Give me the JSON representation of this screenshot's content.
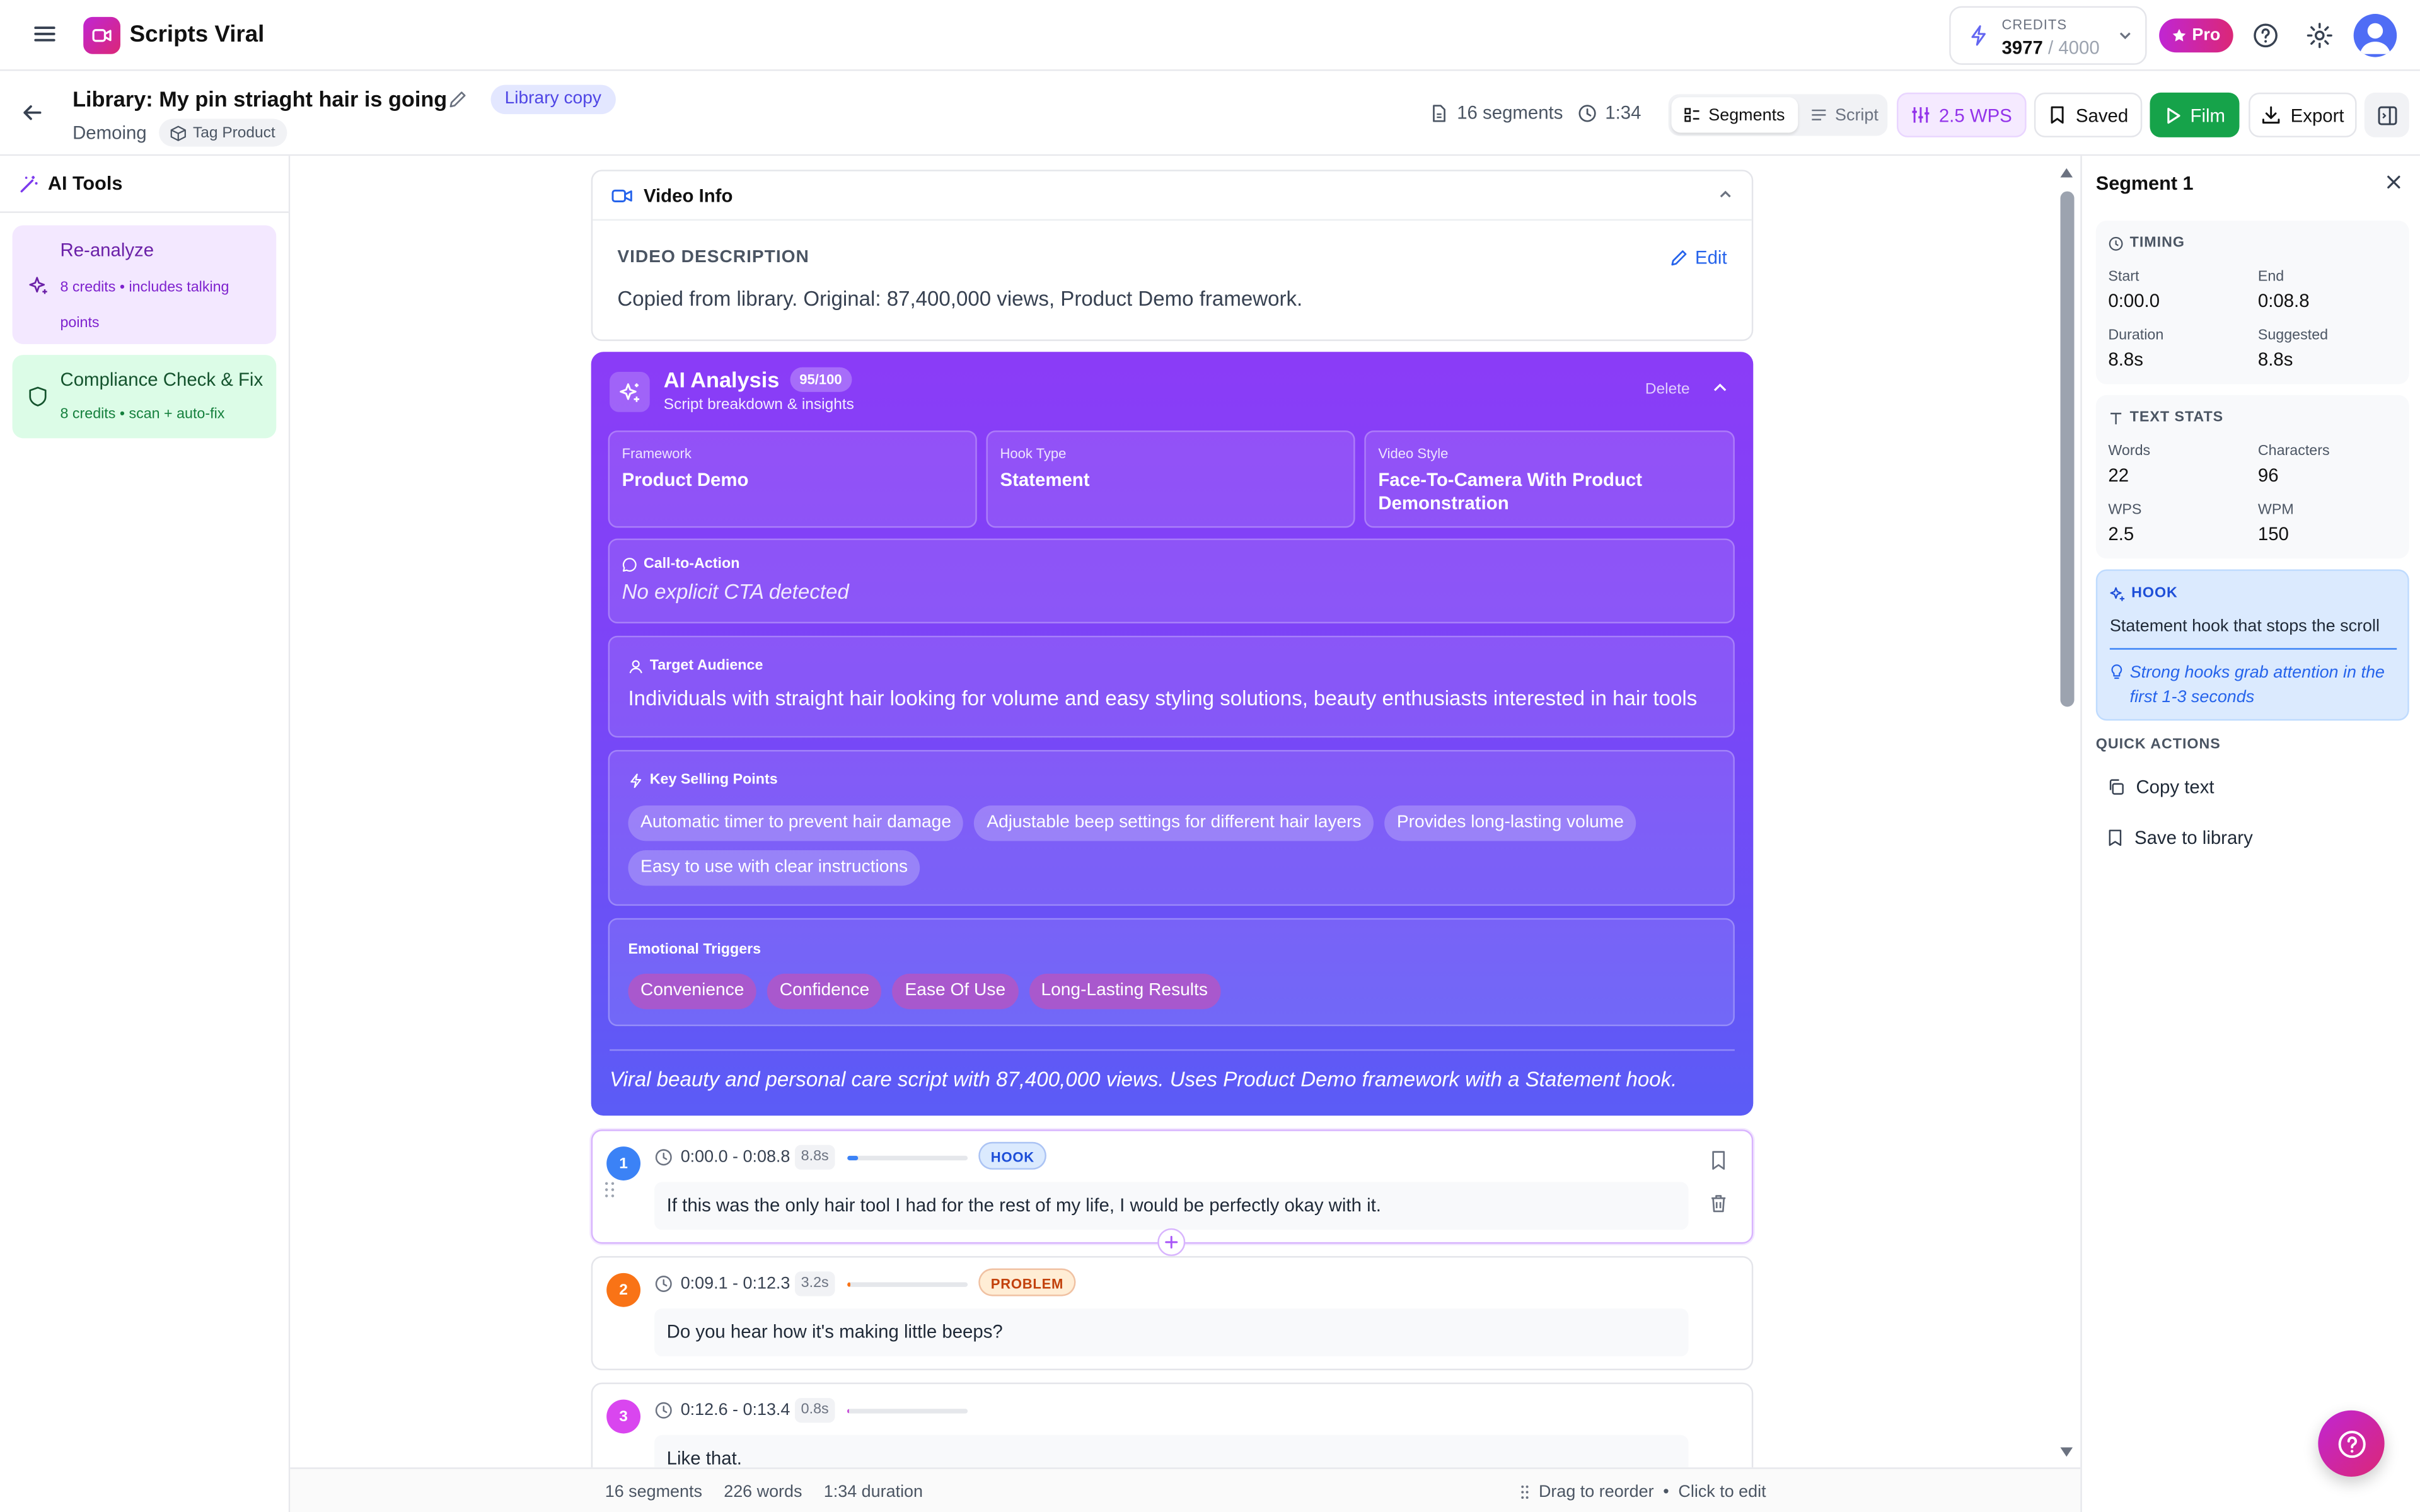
{
  "app": {
    "name": "Scripts Viral"
  },
  "credits": {
    "label": "CREDITS",
    "used": "3977",
    "total": "/ 4000"
  },
  "plan": {
    "badge": "Pro"
  },
  "header": {
    "title": "Library: My pin striaght hair is going",
    "badge": "Library copy",
    "subtitle": "Demoing",
    "tag": "Tag Product",
    "segments": "16 segments",
    "duration": "1:34",
    "view_segments": "Segments",
    "view_script": "Script",
    "wps": "2.5 WPS",
    "saved": "Saved",
    "film": "Film",
    "export": "Export"
  },
  "sidebar": {
    "title": "AI Tools",
    "tools": [
      {
        "title": "Re-analyze",
        "desc": "8 credits • includes talking points"
      },
      {
        "title": "Compliance Check & Fix",
        "desc": "8 credits • scan + auto-fix"
      }
    ]
  },
  "video_info": {
    "title": "Video Info",
    "label": "VIDEO DESCRIPTION",
    "edit": "Edit",
    "text": "Copied from library. Original: 87,400,000 views, Product Demo framework."
  },
  "ai_analysis": {
    "title": "AI Analysis",
    "score": "95/100",
    "subtitle": "Script breakdown & insights",
    "delete": "Delete",
    "framework_label": "Framework",
    "framework": "Product Demo",
    "hook_type_label": "Hook Type",
    "hook_type": "Statement",
    "video_style_label": "Video Style",
    "video_style": "Face-To-Camera With Product Demonstration",
    "cta_label": "Call-to-Action",
    "cta": "No explicit CTA detected",
    "audience_label": "Target Audience",
    "audience": "Individuals with straight hair looking for volume and easy styling solutions, beauty enthusiasts interested in hair tools",
    "selling_label": "Key Selling Points",
    "selling_points": [
      "Automatic timer to prevent hair damage",
      "Adjustable beep settings for different hair layers",
      "Provides long-lasting volume",
      "Easy to use with clear instructions"
    ],
    "emotional_label": "Emotional Triggers",
    "emotional_triggers": [
      "Convenience",
      "Confidence",
      "Ease Of Use",
      "Long-Lasting Results"
    ],
    "summary": "Viral beauty and personal care script with 87,400,000 views. Uses Product Demo framework with a Statement hook."
  },
  "segments": [
    {
      "num": "1",
      "time": "0:00.0 - 0:08.8",
      "dur": "8.8s",
      "tag": "HOOK",
      "text": "If this was the only hair tool I had for the rest of my life, I would be perfectly okay with it.",
      "progress": 0.09,
      "color": "#3b82f6",
      "fill_color": "#3b82f6",
      "tag_bg": "#dbeafe",
      "tag_color": "#1d4ed8"
    },
    {
      "num": "2",
      "time": "0:09.1 - 0:12.3",
      "dur": "3.2s",
      "tag": "PROBLEM",
      "text": "Do you hear how it's making little beeps?",
      "progress": 0.03,
      "color": "#f97316",
      "fill_color": "#f97316",
      "tag_bg": "#ffedd5",
      "tag_color": "#c2410c"
    },
    {
      "num": "3",
      "time": "0:12.6 - 0:13.4",
      "dur": "0.8s",
      "tag": "",
      "text": "Like that.",
      "progress": 0.01,
      "color": "#d946ef",
      "fill_color": "#c026d3",
      "tag_bg": "",
      "tag_color": ""
    }
  ],
  "footer": {
    "segments": "16 segments",
    "words": "226 words",
    "duration": "1:34 duration",
    "drag": "Drag to reorder",
    "sep": "•",
    "click": "Click to edit"
  },
  "right_panel": {
    "title": "Segment 1",
    "timing_label": "TIMING",
    "start_label": "Start",
    "start": "0:00.0",
    "end_label": "End",
    "end": "0:08.8",
    "duration_label": "Duration",
    "duration": "8.8s",
    "suggested_label": "Suggested",
    "suggested": "8.8s",
    "text_stats_label": "TEXT STATS",
    "words_label": "Words",
    "words": "22",
    "chars_label": "Characters",
    "chars": "96",
    "wps_label": "WPS",
    "wps": "2.5",
    "wpm_label": "WPM",
    "wpm": "150",
    "hook_label": "HOOK",
    "hook_text": "Statement hook that stops the scroll",
    "hook_tip": "Strong hooks grab attention in the first 1-3 seconds",
    "quick_actions_label": "QUICK ACTIONS",
    "copy": "Copy text",
    "save": "Save to library"
  }
}
